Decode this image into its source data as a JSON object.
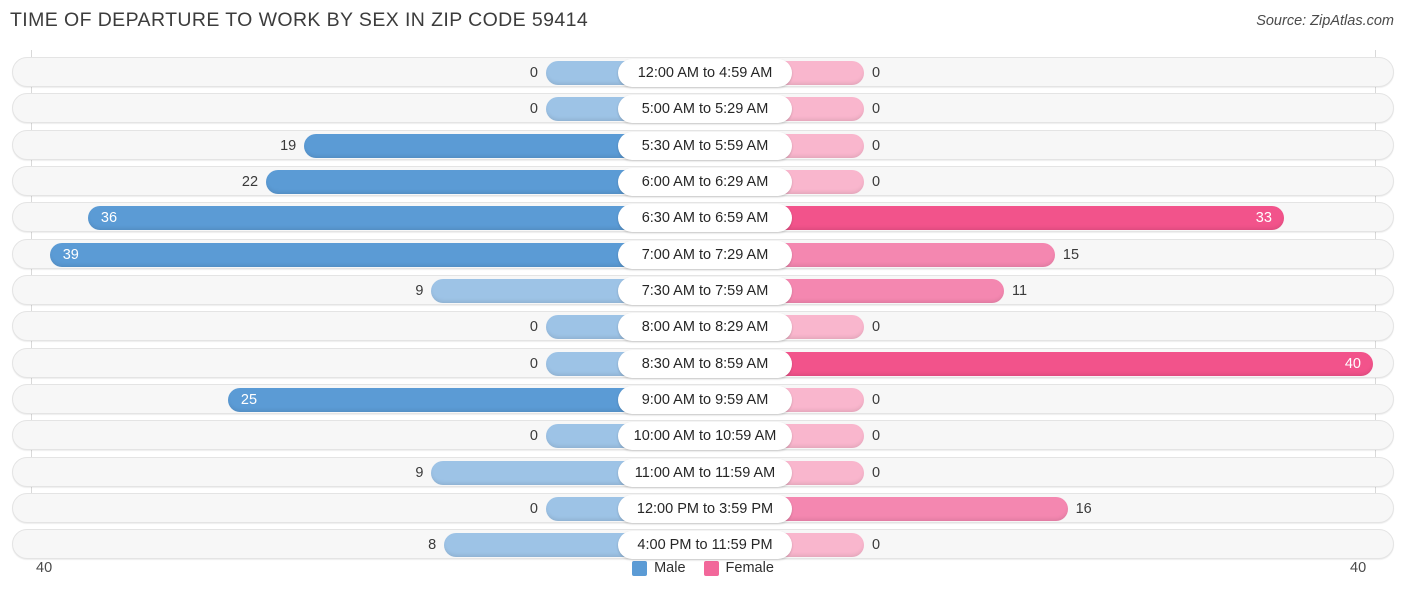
{
  "header": {
    "title": "TIME OF DEPARTURE TO WORK BY SEX IN ZIP CODE 59414",
    "source": "Source: ZipAtlas.com"
  },
  "axis": {
    "left_max_label": "40",
    "right_max_label": "40"
  },
  "legend": [
    {
      "label": "Male",
      "color": "#5b9bd5"
    },
    {
      "label": "Female",
      "color": "#f2679a"
    }
  ],
  "colors": {
    "male_light": "#9dc3e6",
    "male_dark": "#5b9bd5",
    "female_light": "#f9b6cd",
    "female_mid": "#f487b0",
    "female_dark": "#f2538b",
    "row_track": "#f7f7f7",
    "row_border": "#e4e4e4",
    "gridline": "#d9d9d9"
  },
  "chart_data": {
    "type": "bar",
    "orientation": "horizontal-diverging",
    "title": "TIME OF DEPARTURE TO WORK BY SEX IN ZIP CODE 59414",
    "xlabel": "",
    "ylabel": "",
    "xlim": [
      40,
      40
    ],
    "grid": true,
    "legend_position": "bottom-center",
    "categories": [
      "12:00 AM to 4:59 AM",
      "5:00 AM to 5:29 AM",
      "5:30 AM to 5:59 AM",
      "6:00 AM to 6:29 AM",
      "6:30 AM to 6:59 AM",
      "7:00 AM to 7:29 AM",
      "7:30 AM to 7:59 AM",
      "8:00 AM to 8:29 AM",
      "8:30 AM to 8:59 AM",
      "9:00 AM to 9:59 AM",
      "10:00 AM to 10:59 AM",
      "11:00 AM to 11:59 AM",
      "12:00 PM to 3:59 PM",
      "4:00 PM to 11:59 PM"
    ],
    "series": [
      {
        "name": "Male",
        "values": [
          0,
          0,
          19,
          22,
          36,
          39,
          9,
          0,
          0,
          25,
          0,
          9,
          0,
          8
        ]
      },
      {
        "name": "Female",
        "values": [
          0,
          0,
          0,
          0,
          33,
          15,
          11,
          0,
          40,
          0,
          0,
          0,
          16,
          0
        ]
      }
    ]
  },
  "rows": [
    {
      "category": "12:00 AM to 4:59 AM",
      "male": "0",
      "female": "0"
    },
    {
      "category": "5:00 AM to 5:29 AM",
      "male": "0",
      "female": "0"
    },
    {
      "category": "5:30 AM to 5:59 AM",
      "male": "19",
      "female": "0"
    },
    {
      "category": "6:00 AM to 6:29 AM",
      "male": "22",
      "female": "0"
    },
    {
      "category": "6:30 AM to 6:59 AM",
      "male": "36",
      "female": "33"
    },
    {
      "category": "7:00 AM to 7:29 AM",
      "male": "39",
      "female": "15"
    },
    {
      "category": "7:30 AM to 7:59 AM",
      "male": "9",
      "female": "11"
    },
    {
      "category": "8:00 AM to 8:29 AM",
      "male": "0",
      "female": "0"
    },
    {
      "category": "8:30 AM to 8:59 AM",
      "male": "0",
      "female": "40"
    },
    {
      "category": "9:00 AM to 9:59 AM",
      "male": "25",
      "female": "0"
    },
    {
      "category": "10:00 AM to 10:59 AM",
      "male": "0",
      "female": "0"
    },
    {
      "category": "11:00 AM to 11:59 AM",
      "male": "9",
      "female": "0"
    },
    {
      "category": "12:00 PM to 3:59 PM",
      "male": "0",
      "female": "16"
    },
    {
      "category": "4:00 PM to 11:59 PM",
      "male": "8",
      "female": "0"
    }
  ]
}
